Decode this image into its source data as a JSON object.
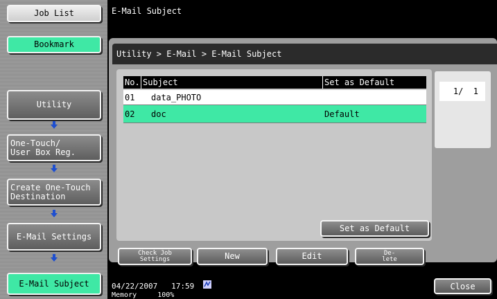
{
  "sidebar": {
    "job_list": "Job List",
    "bookmark": "Bookmark",
    "utility": "Utility",
    "one_touch_line1": "One-Touch/",
    "one_touch_line2": "User Box Reg.",
    "create_line1": "Create One-Touch",
    "create_line2": "Destination",
    "email_settings": "E-Mail Settings",
    "email_subject": "E-Mail Subject"
  },
  "header": {
    "title": "E-Mail Subject"
  },
  "breadcrumb": "Utility > E-Mail > E-Mail Subject",
  "table": {
    "headers": {
      "no": "No.",
      "subject": "Subject",
      "default": "Set as Default"
    },
    "rows": [
      {
        "no": "01",
        "subject": "data_PHOTO",
        "default": ""
      },
      {
        "no": "02",
        "subject": "doc",
        "default": "Default"
      }
    ]
  },
  "pager": {
    "label": "1/  1"
  },
  "buttons": {
    "set_default": "Set as Default",
    "check_job_line1": "Check Job",
    "check_job_line2": "Settings",
    "new": "New",
    "edit": "Edit",
    "delete_line1": "De-",
    "delete_line2": "lete",
    "close": "Close"
  },
  "status": {
    "date": "04/22/2007",
    "time": "17:59",
    "memory_label": "Memory",
    "memory_value": "100%"
  },
  "colors": {
    "accent_green": "#3fe8a5",
    "arrow_blue": "#1e4fd0"
  }
}
